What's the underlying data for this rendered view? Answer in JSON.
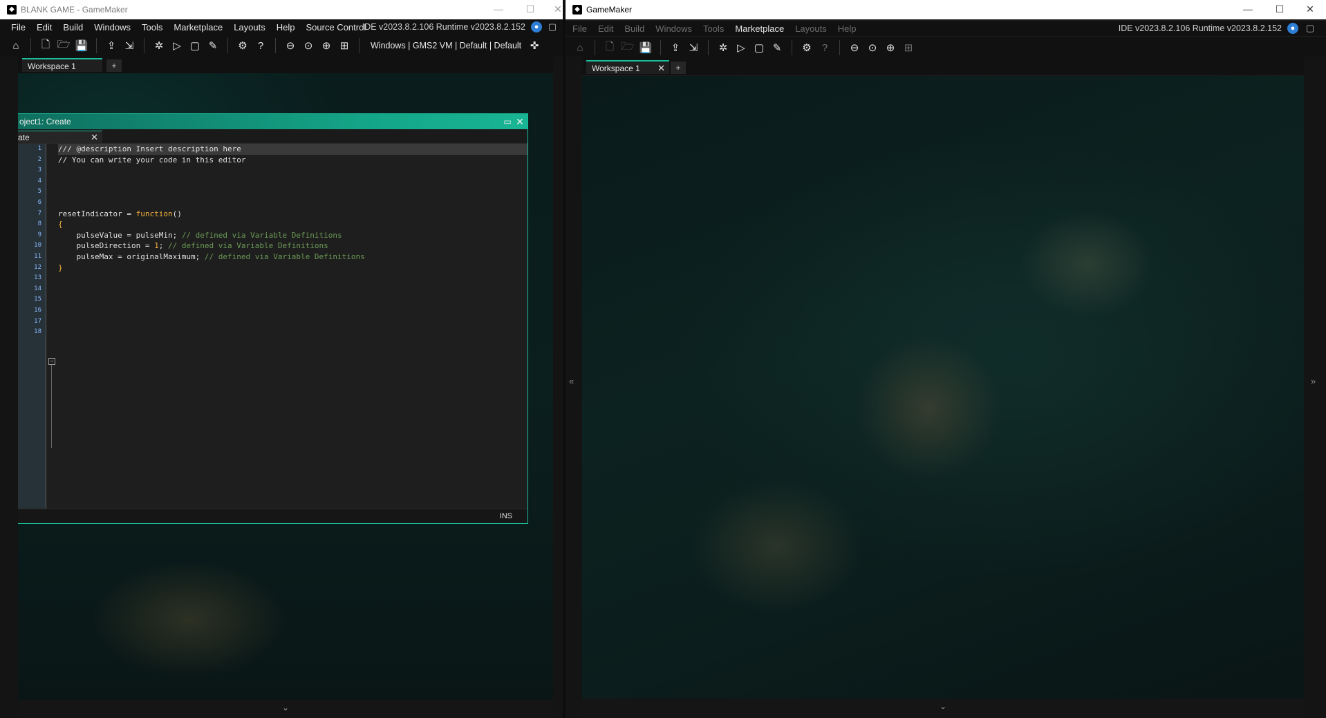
{
  "left_window": {
    "title": "BLANK GAME - GameMaker",
    "menu": [
      "File",
      "Edit",
      "Build",
      "Windows",
      "Tools",
      "Marketplace",
      "Layouts",
      "Help",
      "Source Control"
    ],
    "version": "IDE v2023.8.2.106  Runtime v2023.8.2.152",
    "target": "Windows | GMS2 VM | Default | Default",
    "workspace_tab": "Workspace 1",
    "add_tab": "+",
    "editor": {
      "title": "oject1: Create",
      "tab_label": "ate",
      "status": "INS",
      "line_numbers": [
        "1",
        "2",
        "3",
        "4",
        "5",
        "6",
        "7",
        "8",
        "9",
        "10",
        "11",
        "12",
        "13",
        "14",
        "15",
        "16",
        "17",
        "18"
      ],
      "code_lines": [
        "/// @description Insert description here",
        "// You can write your code in this editor",
        "",
        "",
        "",
        "",
        "resetIndicator = function()",
        "{",
        "    pulseValue = pulseMin; // defined via Variable Definitions",
        "    pulseDirection = 1; // defined via Variable Definitions",
        "    pulseMax = originalMaximum; // defined via Variable Definitions",
        "}",
        "",
        "",
        "",
        "",
        "",
        ""
      ]
    }
  },
  "right_window": {
    "title": "GameMaker",
    "menu": [
      "File",
      "Edit",
      "Build",
      "Windows",
      "Tools",
      "Marketplace",
      "Layouts",
      "Help"
    ],
    "active_menu": "Marketplace",
    "version": "IDE v2023.8.2.106  Runtime v2023.8.2.152",
    "workspace_tab": "Workspace 1",
    "add_tab": "+"
  },
  "colors": {
    "accent": "#1bbf9c",
    "user_badge": "#2d7fd6"
  }
}
